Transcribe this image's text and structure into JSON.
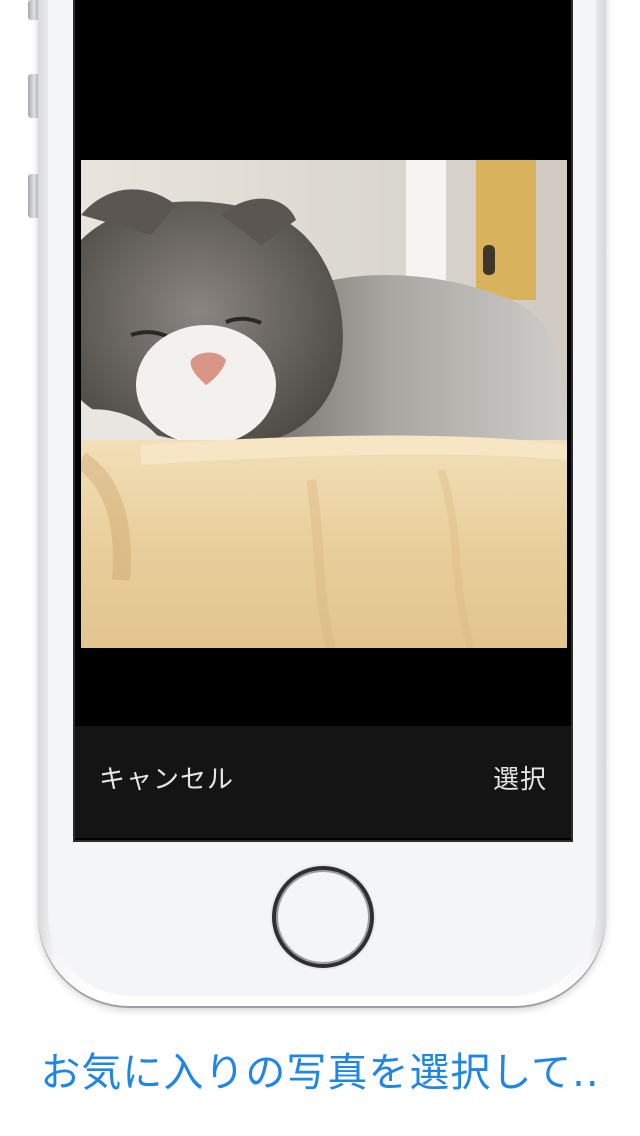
{
  "toolbar": {
    "cancel_label": "キャンセル",
    "select_label": "選択"
  },
  "caption": "お気に入りの写真を選択して..",
  "colors": {
    "caption_blue": "#1f86e6",
    "toolbar_bg": "#141414",
    "screen_bg": "#000000"
  },
  "photo": {
    "subject": "sleeping scottish fold cat in wooden bowl"
  }
}
